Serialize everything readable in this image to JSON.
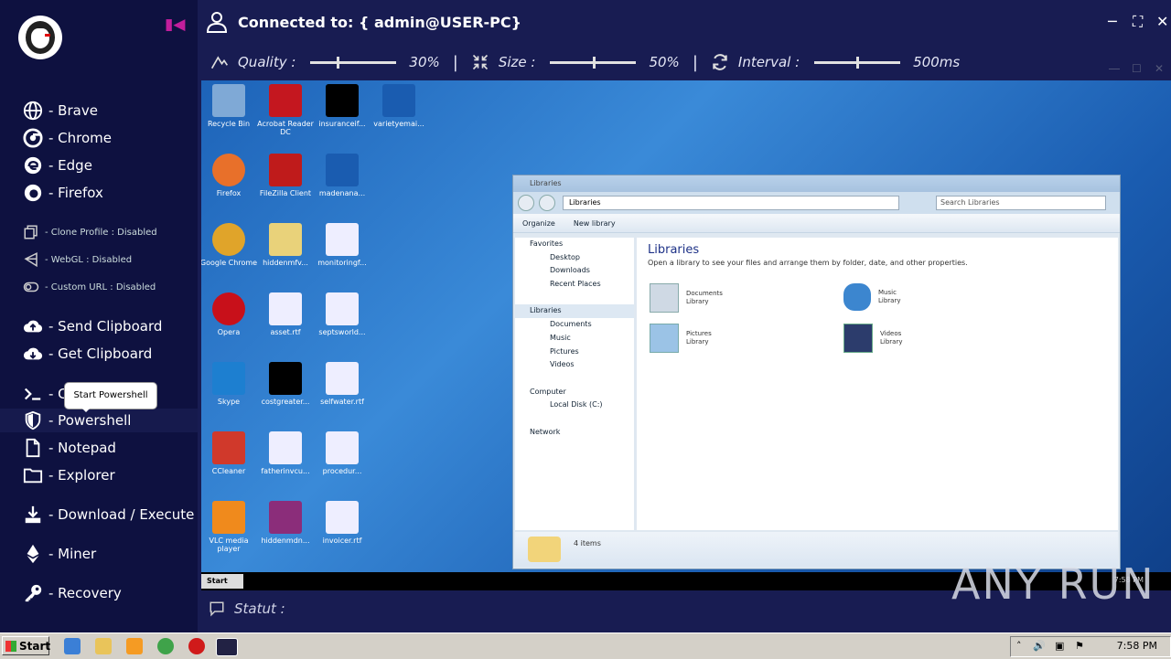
{
  "header": {
    "title": "Connected to: { admin@USER-PC}"
  },
  "toolbar": {
    "quality_label": "Quality :",
    "quality_value": "30%",
    "quality_level": 0.3,
    "size_label": "Size :",
    "size_value": "50%",
    "size_level": 0.5,
    "interval_label": "Interval :",
    "interval_value": "500ms",
    "separator": "|"
  },
  "sidebar": {
    "browsers": [
      {
        "label": "- Brave",
        "icon": "globe-icon"
      },
      {
        "label": "- Chrome",
        "icon": "chrome-icon"
      },
      {
        "label": "- Edge",
        "icon": "edge-icon"
      },
      {
        "label": "- Firefox",
        "icon": "firefox-icon"
      }
    ],
    "options": [
      {
        "label": "- Clone Profile : Disabled",
        "icon": "copy-icon"
      },
      {
        "label": "- WebGL : Disabled",
        "icon": "webgl-icon"
      },
      {
        "label": "- Custom URL : Disabled",
        "icon": "toggle-icon"
      }
    ],
    "clipboard": [
      {
        "label": "- Send Clipboard",
        "icon": "cloud-upload-icon"
      },
      {
        "label": "- Get Clipboard",
        "icon": "cloud-download-icon"
      }
    ],
    "cmd_label": "- C",
    "powershell_label": "- Powershell",
    "notepad_label": "- Notepad",
    "explorer_label": "- Explorer",
    "download_label": "- Download / Execute",
    "miner_label": "- Miner",
    "recovery_label": "- Recovery",
    "tooltip": "Start Powershell"
  },
  "remote_desktop": {
    "icons": [
      {
        "label": "Recycle Bin"
      },
      {
        "label": "Acrobat Reader DC"
      },
      {
        "label": "insuranceif..."
      },
      {
        "label": "varietyemai..."
      },
      {
        "label": "Firefox"
      },
      {
        "label": "FileZilla Client"
      },
      {
        "label": "madenana..."
      },
      {
        "label": "Google Chrome"
      },
      {
        "label": "hiddenmfv..."
      },
      {
        "label": "monitoringf..."
      },
      {
        "label": "Opera"
      },
      {
        "label": "asset.rtf"
      },
      {
        "label": "septsworld..."
      },
      {
        "label": "Skype"
      },
      {
        "label": "costgreater..."
      },
      {
        "label": "selfwater.rtf"
      },
      {
        "label": "CCleaner"
      },
      {
        "label": "fatherinvcu..."
      },
      {
        "label": "procedur..."
      },
      {
        "label": "VLC media player"
      },
      {
        "label": "hiddenmdn..."
      },
      {
        "label": "invoicer.rtf"
      }
    ],
    "explorer": {
      "title": "Libraries",
      "breadcrumb": "Libraries",
      "search_placeholder": "Search Libraries",
      "organize": "Organize",
      "new_library": "New library",
      "nav": [
        "Favorites",
        "Desktop",
        "Downloads",
        "Recent Places",
        "",
        "Libraries",
        "Documents",
        "Music",
        "Pictures",
        "Videos",
        "",
        "Computer",
        "Local Disk (C:)",
        "",
        "Network"
      ],
      "heading": "Libraries",
      "subtitle": "Open a library to see your files and arrange them by folder, date, and other properties.",
      "libraries": [
        {
          "name": "Documents",
          "type": "Library"
        },
        {
          "name": "Music",
          "type": "Library"
        },
        {
          "name": "Pictures",
          "type": "Library"
        },
        {
          "name": "Videos",
          "type": "Library"
        }
      ],
      "status": "4 items"
    },
    "start_label": "Start",
    "clock": "7:58 PM"
  },
  "statut": {
    "label": "Statut :"
  },
  "taskbar": {
    "start": "Start",
    "time": "7:58 PM"
  },
  "watermark": "ANY RUN",
  "colors": {
    "sidebar_bg": "#0e1140",
    "window_bg": "#181c52",
    "accent": "#c21e9c",
    "desktop_blue": "#2a76c8"
  }
}
